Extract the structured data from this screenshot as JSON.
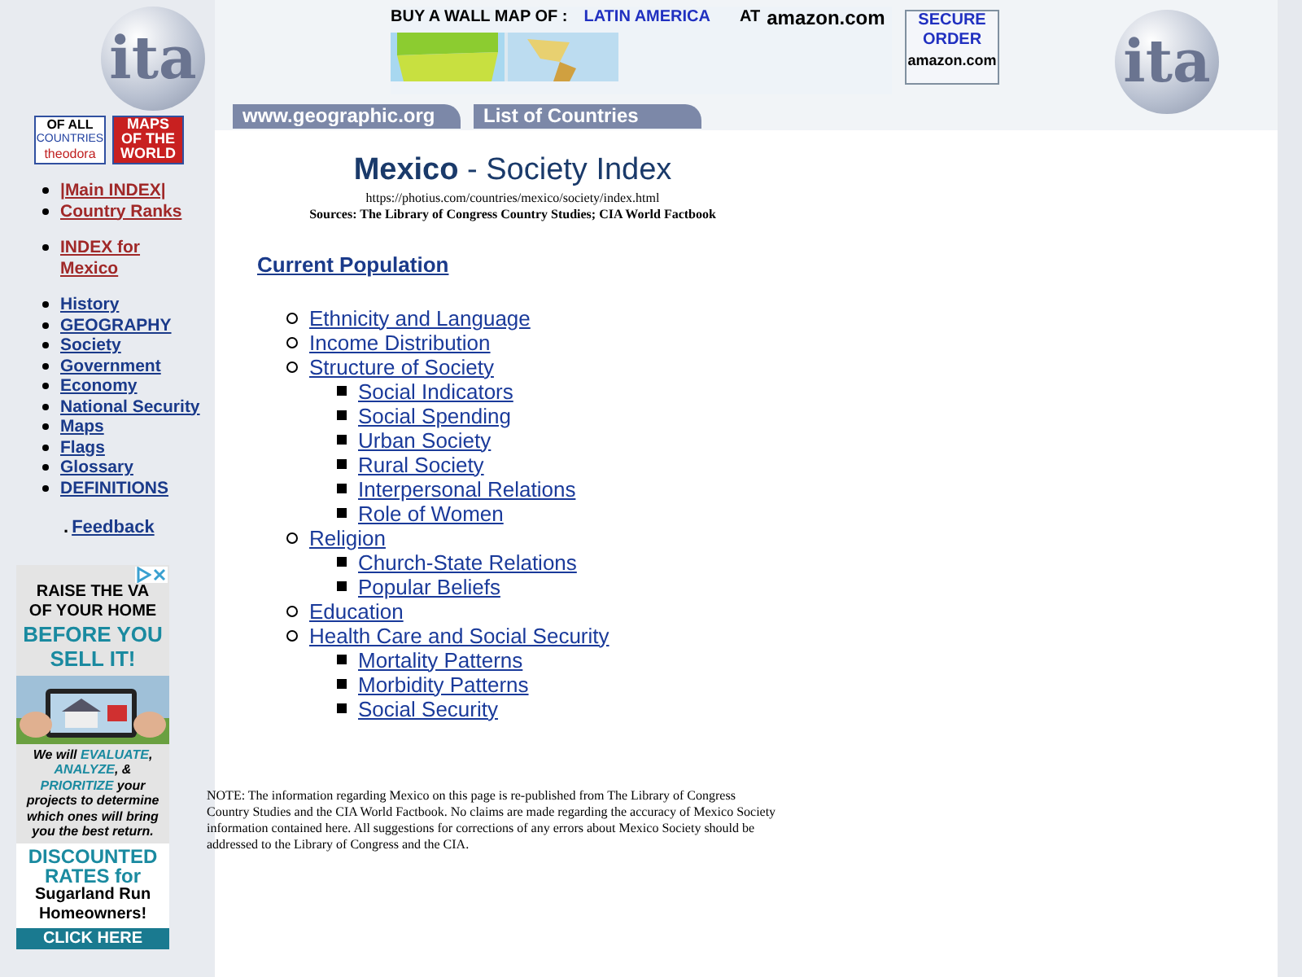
{
  "logos": [
    {
      "text": "ita"
    },
    {
      "text": "ita"
    }
  ],
  "badges": [
    {
      "lines": [
        "OF ALL",
        "COUNTRIES",
        "theodora"
      ]
    },
    {
      "lines": [
        "MAPS",
        "OF THE",
        "WORLD"
      ]
    }
  ],
  "banner": {
    "lead": "BUY A WALL MAP OF :",
    "region": "LATIN AMERICA",
    "at": "AT",
    "store": "amazon.com",
    "secure": [
      "SECURE",
      "ORDER"
    ],
    "secure_store": "amazon.com"
  },
  "tabs": [
    {
      "label": "www.geographic.org"
    },
    {
      "label": "List of Countries"
    }
  ],
  "title": {
    "country": "Mexico",
    "rest": " - Society Index"
  },
  "url": "https://photius.com/countries/mexico/society/index.html",
  "sources": "Sources: The Library of Congress Country Studies; CIA World Factbook",
  "nav_groups": [
    [
      {
        "label": "|Main INDEX|",
        "kind": "red"
      },
      {
        "label": "Country Ranks",
        "kind": "red"
      }
    ],
    [
      {
        "label": "INDEX for Mexico",
        "kind": "red"
      }
    ],
    [
      {
        "label": "History",
        "kind": "blue"
      },
      {
        "label": "GEOGRAPHY",
        "kind": "blue"
      },
      {
        "label": "Society",
        "kind": "blue"
      },
      {
        "label": "Government",
        "kind": "blue"
      },
      {
        "label": "Economy",
        "kind": "blue"
      },
      {
        "label": "National Security",
        "kind": "blue"
      },
      {
        "label": "Maps",
        "kind": "blue"
      },
      {
        "label": "Flags",
        "kind": "blue"
      },
      {
        "label": "Glossary",
        "kind": "blue"
      },
      {
        "label": "DEFINITIONS",
        "kind": "blue"
      }
    ]
  ],
  "feedback": {
    "dot": ".",
    "label": "Feedback"
  },
  "ad": {
    "headline": [
      "RAISE THE VA",
      "OF YOUR HOME"
    ],
    "call": [
      "BEFORE YOU",
      "SELL IT!"
    ],
    "body": "We will **EVALUATE**, **ANALYZE**, & **PRIORITIZE** your projects to determine which ones will bring you the best return.",
    "offer": [
      "DISCOUNTED",
      "RATES for",
      "Sugarland Run",
      "Homeowners!"
    ],
    "button": "CLICK HERE"
  },
  "section": "Current Population",
  "topics": [
    {
      "label": "Ethnicity and Language"
    },
    {
      "label": "Income Distribution"
    },
    {
      "label": "Structure of Society",
      "children": [
        {
          "label": "Social Indicators"
        },
        {
          "label": "Social Spending"
        },
        {
          "label": "Urban Society"
        },
        {
          "label": "Rural Society"
        },
        {
          "label": "Interpersonal Relations"
        },
        {
          "label": "Role of Women"
        }
      ]
    },
    {
      "label": "Religion",
      "children": [
        {
          "label": "Church-State Relations"
        },
        {
          "label": "Popular Beliefs"
        }
      ]
    },
    {
      "label": "Education"
    },
    {
      "label": "Health Care and Social Security",
      "children": [
        {
          "label": "Mortality Patterns"
        },
        {
          "label": "Morbidity Patterns"
        },
        {
          "label": "Social Security"
        }
      ]
    }
  ],
  "note": "NOTE: The information regarding Mexico on this page is re-published from The Library of Congress Country Studies and the CIA World Factbook. No claims are made regarding the accuracy of Mexico Society information contained here. All suggestions for corrections of any errors about Mexico Society should be addressed to the Library of Congress and the CIA."
}
